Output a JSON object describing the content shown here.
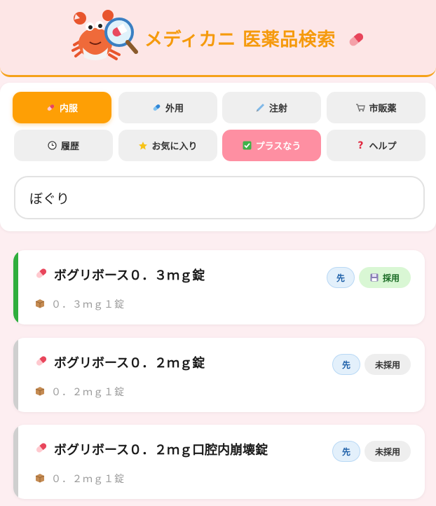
{
  "header": {
    "title": "メディカニ 医薬品検索",
    "mascot_icon": "crab-magnifier-mascot",
    "pill_icon": "pill-icon"
  },
  "tabs": [
    {
      "label": "内服",
      "icon": "pill-icon",
      "state": "active"
    },
    {
      "label": "外用",
      "icon": "capsule-icon",
      "state": "normal"
    },
    {
      "label": "注射",
      "icon": "syringe-icon",
      "state": "normal"
    },
    {
      "label": "市販薬",
      "icon": "cart-icon",
      "state": "normal"
    },
    {
      "label": "履歴",
      "icon": "clock-icon",
      "state": "normal"
    },
    {
      "label": "お気に入り",
      "icon": "star-icon",
      "state": "normal"
    },
    {
      "label": "プラスなう",
      "icon": "check-icon",
      "state": "highlight"
    },
    {
      "label": "ヘルプ",
      "icon": "question-icon",
      "state": "normal"
    }
  ],
  "search": {
    "value": "ぼぐり",
    "placeholder": ""
  },
  "results": [
    {
      "name": "ボグリボース０．３ｍｇ錠",
      "spec": "０．３ｍｇ１錠",
      "badge_type": "先",
      "status": "採用",
      "adopted": true
    },
    {
      "name": "ボグリボース０．２ｍｇ錠",
      "spec": "０．２ｍｇ１錠",
      "badge_type": "先",
      "status": "未採用",
      "adopted": false
    },
    {
      "name": "ボグリボース０．２ｍｇ口腔内崩壊錠",
      "spec": "０．２ｍｇ１錠",
      "badge_type": "先",
      "status": "未採用",
      "adopted": false
    }
  ],
  "colors": {
    "accent": "#fe9f05",
    "highlight": "#fe8fa2",
    "adopted_bar": "#2fae3d",
    "not_adopted_bar": "#cfcfcf"
  }
}
